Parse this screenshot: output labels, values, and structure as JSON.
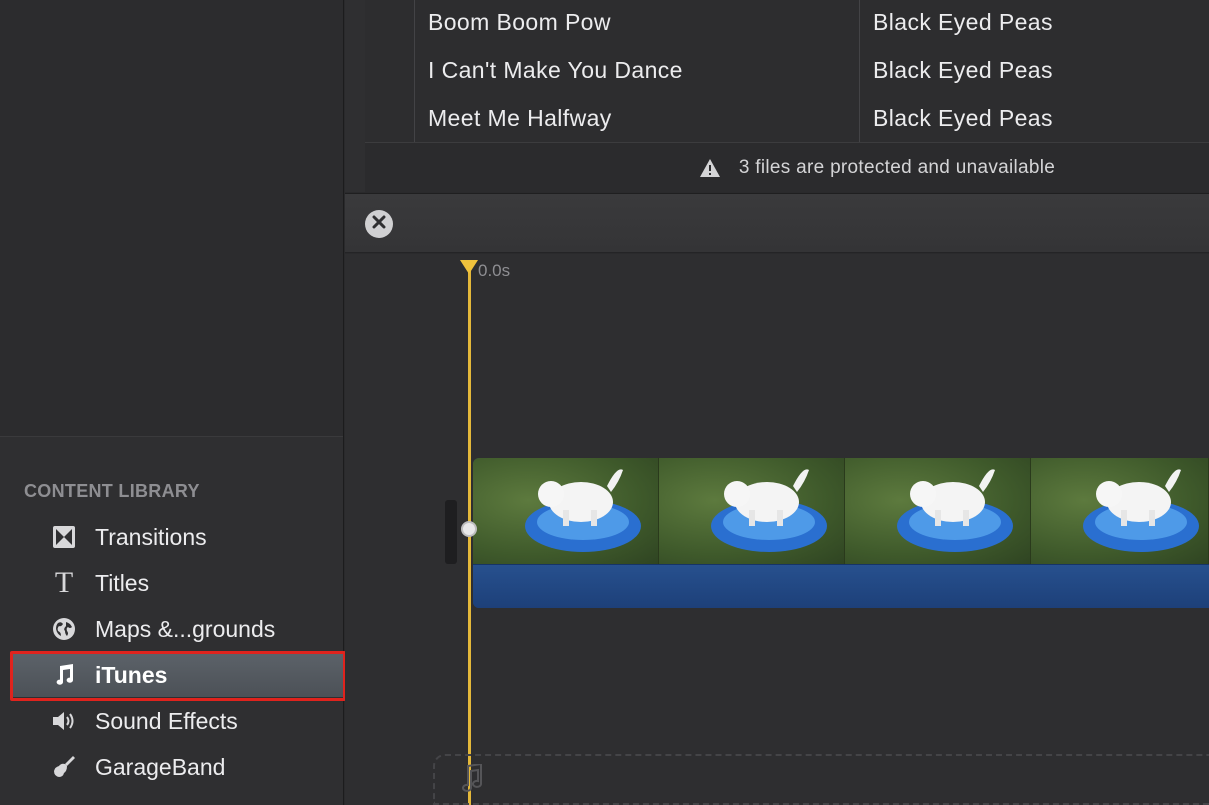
{
  "content_library": {
    "heading": "CONTENT LIBRARY",
    "items": [
      {
        "label": "Transitions",
        "icon": "transitions-icon"
      },
      {
        "label": "Titles",
        "icon": "titles-icon",
        "glyph": "T"
      },
      {
        "label": "Maps &...grounds",
        "icon": "globe-icon"
      },
      {
        "label": "iTunes",
        "icon": "music-note-icon",
        "selected": true
      },
      {
        "label": "Sound Effects",
        "icon": "speaker-icon"
      },
      {
        "label": "GarageBand",
        "icon": "guitar-icon"
      }
    ]
  },
  "song_list": {
    "rows": [
      {
        "title": "Boom Boom Pow",
        "artist": "Black Eyed Peas"
      },
      {
        "title": "I Can't Make You Dance",
        "artist": "Black Eyed Peas"
      },
      {
        "title": "Meet Me Halfway",
        "artist": "Black Eyed Peas"
      }
    ],
    "notice": "3 files are protected and unavailable"
  },
  "timeline": {
    "playhead_time": "0.0s"
  },
  "colors": {
    "accent_selection": "#555b62",
    "highlight_border": "#e0231d",
    "playhead": "#e4b83a",
    "audio_bar": "#1d4079"
  }
}
